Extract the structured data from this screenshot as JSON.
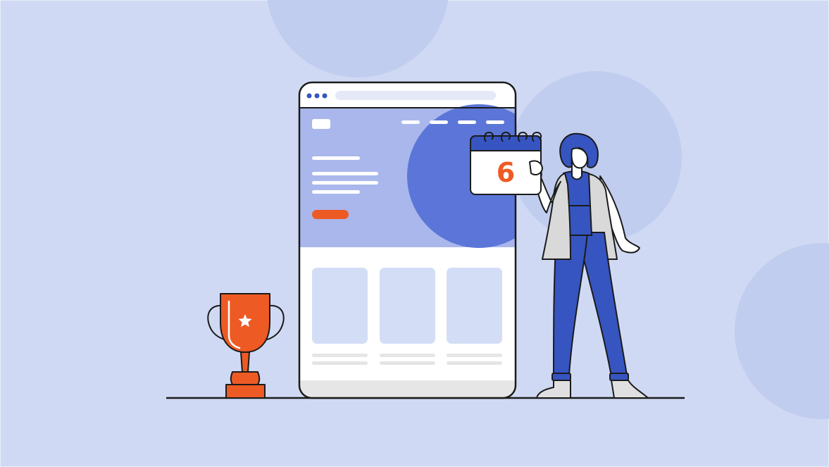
{
  "illustration": {
    "calendar": {
      "day_number": "6"
    },
    "palette": {
      "background": "#d0d9f4",
      "background_circle": "#c1cdef",
      "outline": "#1b1b1b",
      "hero_light": "#a9b7ec",
      "hero_dark": "#5b76d8",
      "accent_orange": "#ee5a24",
      "person_blue": "#3655c1",
      "card": "#d3ddf6",
      "gray_line": "#e5e5e5",
      "white": "#ffffff"
    },
    "icons": {
      "trophy": "trophy-icon",
      "star": "star-icon",
      "calendar": "calendar-icon",
      "browser": "browser-window",
      "person": "woman-figure"
    }
  }
}
